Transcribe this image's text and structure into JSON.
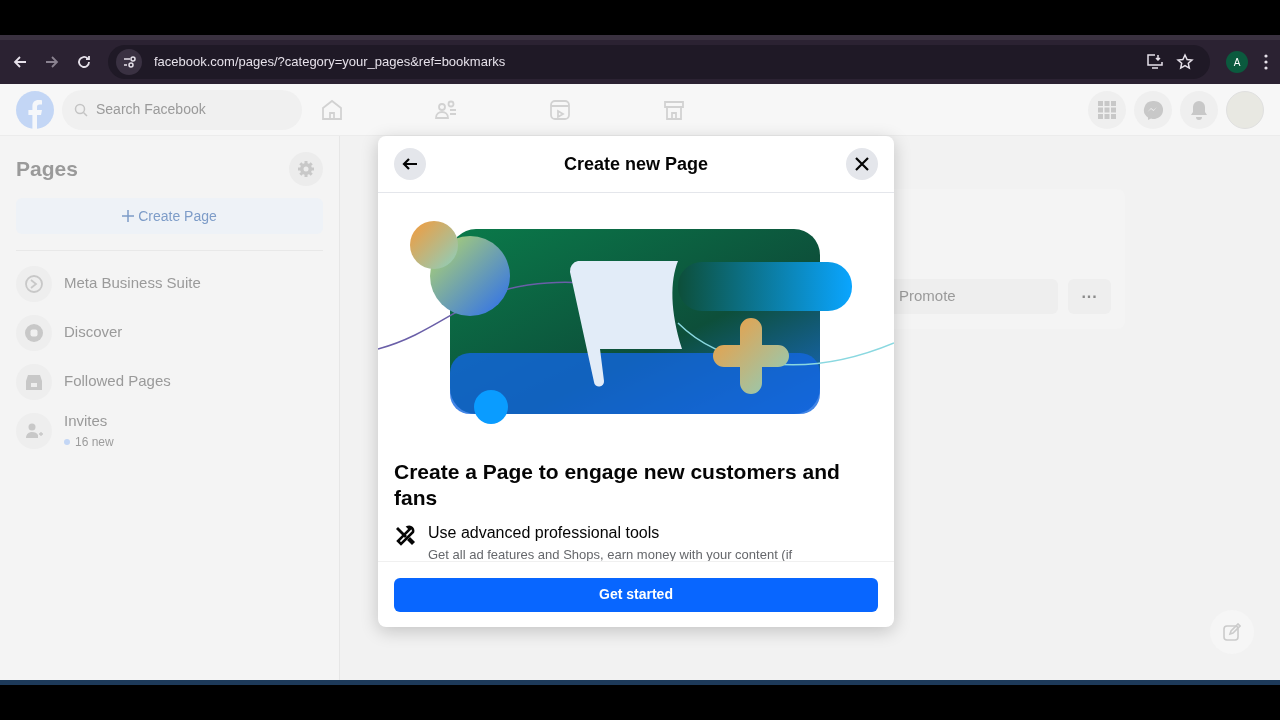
{
  "browser": {
    "url": "facebook.com/pages/?category=your_pages&ref=bookmarks",
    "profile_initial": "A"
  },
  "header": {
    "search_placeholder": "Search Facebook"
  },
  "sidebar": {
    "title": "Pages",
    "create_button": "Create Page",
    "items": [
      {
        "label": "Meta Business Suite"
      },
      {
        "label": "Discover"
      },
      {
        "label": "Followed Pages"
      },
      {
        "label": "Invites",
        "subtitle": "16 new"
      }
    ]
  },
  "page_card": {
    "promote_button": "Promote",
    "more_button": "···"
  },
  "dialog": {
    "title": "Create new Page",
    "heading": "Create a Page to engage new customers and fans",
    "features": [
      {
        "title": "Use advanced professional tools",
        "description": "Get all ad features and Shops, earn money with your content (if"
      }
    ],
    "button": "Get started"
  }
}
